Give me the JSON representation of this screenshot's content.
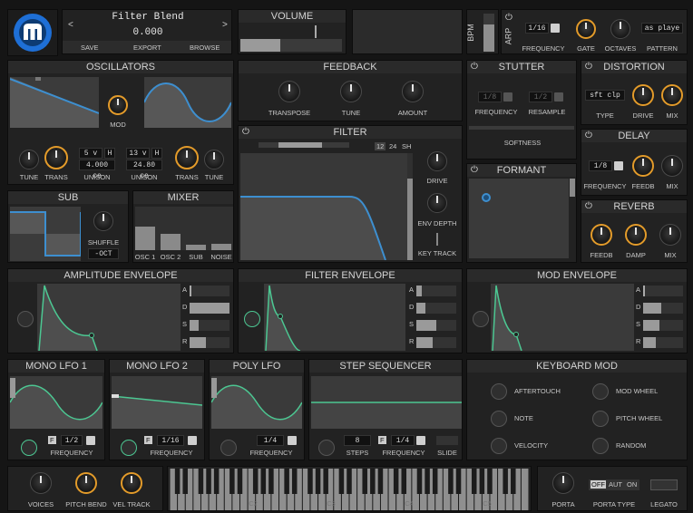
{
  "header": {
    "patch_name": "Filter Blend",
    "value": "0.000",
    "prev_label": "<",
    "next_label": ">",
    "save_label": "SAVE",
    "export_label": "EXPORT",
    "browse_label": "BROWSE"
  },
  "volume": {
    "title": "VOLUME"
  },
  "bpm": {
    "label": "BPM"
  },
  "arp": {
    "label": "ARP",
    "frequency_value": "1/16",
    "frequency_label": "FREQUENCY",
    "gate_label": "GATE",
    "octaves_label": "OCTAVES",
    "pattern_value": "as playe",
    "pattern_label": "PATTERN"
  },
  "oscillators": {
    "title": "OSCILLATORS",
    "mod_label": "MOD",
    "tune_label": "TUNE",
    "trans_label": "TRANS",
    "unison_label": "UNISON",
    "osc1": {
      "voices": "5 v",
      "h": "H",
      "detune": "4.000 ce"
    },
    "osc2": {
      "voices": "13 v",
      "h": "H",
      "detune": "24.80 ce"
    }
  },
  "feedback": {
    "title": "FEEDBACK",
    "transpose_label": "TRANSPOSE",
    "tune_label": "TUNE",
    "amount_label": "AMOUNT"
  },
  "stutter": {
    "title": "STUTTER",
    "frequency_value": "1/8",
    "frequency_label": "FREQUENCY",
    "resample_value": "1/2",
    "resample_label": "RESAMPLE",
    "softness_label": "SOFTNESS"
  },
  "distortion": {
    "title": "DISTORTION",
    "type_value": "sft clp",
    "type_label": "TYPE",
    "drive_label": "DRIVE",
    "mix_label": "MIX"
  },
  "filter": {
    "title": "FILTER",
    "db12": "12",
    "db24": "24",
    "sh": "SH",
    "drive_label": "DRIVE",
    "env_depth_label": "ENV DEPTH",
    "key_track_label": "KEY TRACK"
  },
  "delay": {
    "title": "DELAY",
    "frequency_value": "1/8",
    "frequency_label": "FREQUENCY",
    "feedb_label": "FEEDB",
    "mix_label": "MIX"
  },
  "formant": {
    "title": "FORMANT"
  },
  "reverb": {
    "title": "REVERB",
    "feedb_label": "FEEDB",
    "damp_label": "DAMP",
    "mix_label": "MIX"
  },
  "sub": {
    "title": "SUB",
    "shuffle_label": "SHUFFLE",
    "oct_value": "-OCT"
  },
  "mixer": {
    "title": "MIXER",
    "channels": [
      {
        "label": "OSC 1",
        "level": 0.55
      },
      {
        "label": "OSC 2",
        "level": 0.37
      },
      {
        "label": "SUB",
        "level": 0.12
      },
      {
        "label": "NOISE",
        "level": 0.15
      }
    ]
  },
  "envelopes": {
    "amplitude": {
      "title": "AMPLITUDE ENVELOPE"
    },
    "filter": {
      "title": "FILTER ENVELOPE"
    },
    "mod": {
      "title": "MOD ENVELOPE"
    },
    "params": [
      "A",
      "D",
      "S",
      "R"
    ]
  },
  "lfos": {
    "mono1": {
      "title": "MONO LFO 1",
      "f": "F",
      "freq_value": "1/2",
      "freq_label": "FREQUENCY"
    },
    "mono2": {
      "title": "MONO LFO 2",
      "f": "F",
      "freq_value": "1/16",
      "freq_label": "FREQUENCY"
    },
    "poly": {
      "title": "POLY LFO",
      "freq_value": "1/4",
      "freq_label": "FREQUENCY"
    }
  },
  "step_sequencer": {
    "title": "STEP SEQUENCER",
    "steps_value": "8",
    "steps_label": "STEPS",
    "f": "F",
    "freq_value": "1/4",
    "freq_label": "FREQUENCY",
    "slide_label": "SLIDE"
  },
  "keyboard_mod": {
    "title": "KEYBOARD MOD",
    "sources": [
      "AFTERTOUCH",
      "MOD WHEEL",
      "NOTE",
      "PITCH WHEEL",
      "VELOCITY",
      "RANDOM"
    ]
  },
  "footer": {
    "voices_label": "VOICES",
    "pitch_bend_label": "PITCH BEND",
    "vel_track_label": "VEL TRACK",
    "keys": [
      "C2",
      "C3",
      "C4",
      "C5"
    ],
    "porta_label": "PORTA",
    "porta_off": "OFF",
    "porta_aut": "AUT",
    "porta_on": "ON",
    "porta_type_label": "PORTA TYPE",
    "legato_label": "LEGATO"
  },
  "colors": {
    "accent": "#e39b2a",
    "wave": "#3d8fd0",
    "env": "#4cc792",
    "background": "#151515",
    "panel": "#222222"
  }
}
